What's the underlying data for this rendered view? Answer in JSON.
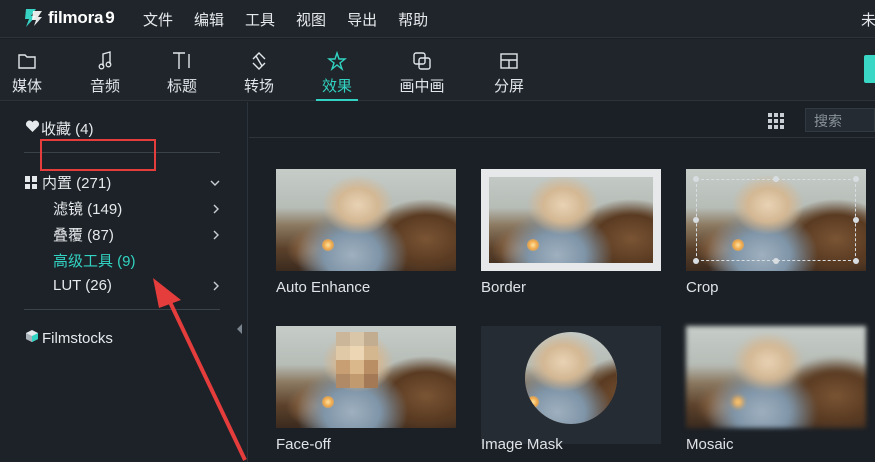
{
  "app": {
    "name": "filmora",
    "version": "9"
  },
  "menu": {
    "items": [
      "文件",
      "编辑",
      "工具",
      "视图",
      "导出",
      "帮助"
    ],
    "right_text": "未"
  },
  "toolbar": {
    "tabs": [
      {
        "label": "媒体",
        "icon": "folder-icon",
        "active": false
      },
      {
        "label": "音频",
        "icon": "music-note-icon",
        "active": false
      },
      {
        "label": "标题",
        "icon": "text-icon",
        "active": false
      },
      {
        "label": "转场",
        "icon": "transition-icon",
        "active": false
      },
      {
        "label": "效果",
        "icon": "effects-icon",
        "active": true
      },
      {
        "label": "画中画",
        "icon": "pip-icon",
        "active": false
      },
      {
        "label": "分屏",
        "icon": "split-screen-icon",
        "active": false
      }
    ],
    "accent_color": "#32d3c2"
  },
  "sidebar": {
    "favorites": "收藏 (4)",
    "builtin": "内置 (271)",
    "items": [
      {
        "label": "滤镜 (149)",
        "has_arrow": true,
        "selected": false
      },
      {
        "label": "叠覆 (87)",
        "has_arrow": true,
        "selected": false
      },
      {
        "label": "高级工具 (9)",
        "has_arrow": false,
        "selected": true
      },
      {
        "label": "LUT (26)",
        "has_arrow": true,
        "selected": false
      }
    ],
    "filmstocks": "Filmstocks",
    "highlight_color": "#e53c3c",
    "selected_color": "#32d3c2"
  },
  "content": {
    "search_placeholder": "搜索",
    "effects": [
      {
        "label": "Auto Enhance",
        "style": "plain"
      },
      {
        "label": "Border",
        "style": "border"
      },
      {
        "label": "Crop",
        "style": "crop"
      },
      {
        "label": "Face-off",
        "style": "face-off"
      },
      {
        "label": "Image Mask",
        "style": "mask"
      },
      {
        "label": "Mosaic",
        "style": "mosaic"
      }
    ]
  }
}
